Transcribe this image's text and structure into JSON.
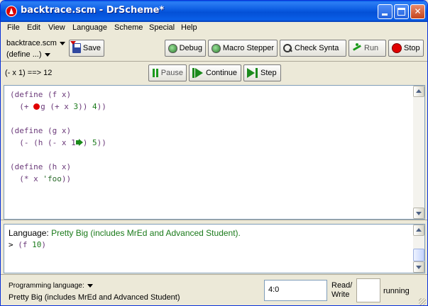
{
  "window": {
    "title": "backtrace.scm - DrScheme*",
    "controls": {
      "minimize": "_",
      "maximize": "□",
      "close": "✕"
    }
  },
  "menu": [
    "File",
    "Edit",
    "View",
    "Language",
    "Scheme",
    "Special",
    "Help"
  ],
  "toolbar": {
    "file_name": "backtrace.scm",
    "define_menu": "(define ...)",
    "save": "Save",
    "debug": "Debug",
    "macro_stepper": "Macro Stepper",
    "check_syntax": "Check Synta",
    "run": "Run",
    "stop": "Stop"
  },
  "debugbar": {
    "status": "(- x 1) ==> 12",
    "pause": "Pause",
    "continue": "Continue",
    "step": "Step"
  },
  "definitions": {
    "line1": "(define (f x)",
    "line2a": "  (+ ",
    "line2b": "g (+ x ",
    "line2c": "3",
    "line2d": ")) ",
    "line2e": "4",
    "line2f": "))",
    "line4": "(define (g x)",
    "line5a": "  (- (h (- x 1",
    "line5b": ") ",
    "line5c": "5",
    "line5d": "))",
    "line7": "(define (h x)",
    "line8a": "  (* x ",
    "line8b": "'foo",
    "line8c": "))"
  },
  "interactions": {
    "lang_prefix": "Language: ",
    "lang_value": "Pretty Big (includes MrEd and Advanced Student).",
    "prompt": "> ",
    "expr_a": "(f ",
    "expr_b": "10",
    "expr_c": ")"
  },
  "status": {
    "programming_language_label": "Programming language:",
    "programming_language_value": "Pretty Big (includes MrEd and Advanced Student)",
    "position": "4:0",
    "read_write_line1": "Read/",
    "read_write_line2": "Write",
    "running": "running"
  },
  "colors": {
    "titlebar": "#0a5ae0",
    "keyword": "#6b3a7a",
    "number": "#1a7a1a",
    "breakpoint": "#e00000",
    "step_arrow": "#1c8a1c"
  },
  "icons": {
    "app": "drscheme-lambda-icon",
    "save": "floppy-disk-icon",
    "debug": "bug-icon",
    "macro_stepper": "bug-icon",
    "check_syntax": "magnifier-icon",
    "run": "running-man-icon",
    "stop": "stop-sign-icon",
    "pause": "pause-icon",
    "continue": "continue-icon",
    "step": "step-icon",
    "breakpoint": "breakpoint-dot-icon",
    "program_counter": "pc-arrow-icon"
  }
}
